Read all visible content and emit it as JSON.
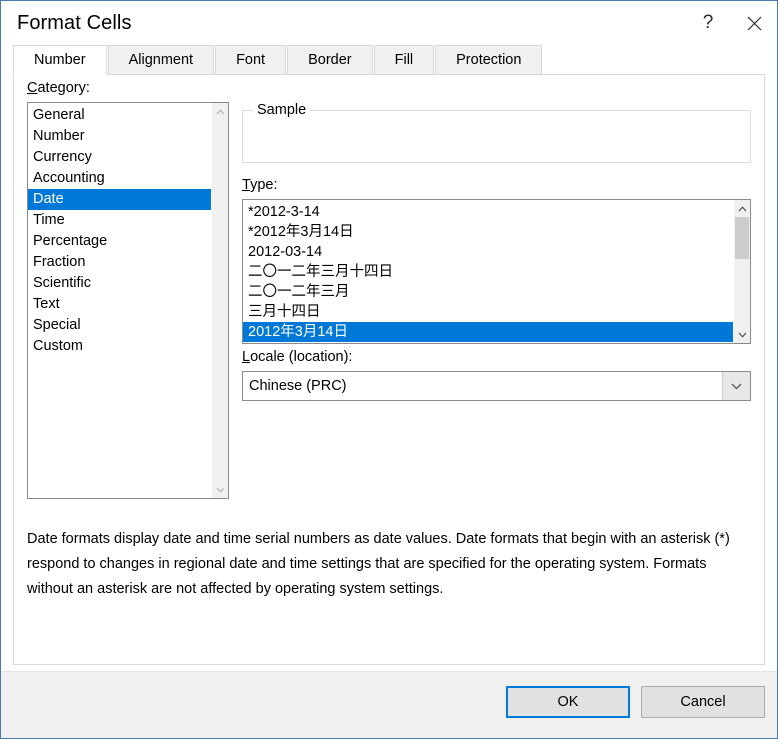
{
  "window": {
    "title": "Format Cells",
    "help_icon": "question-mark-icon",
    "close_icon": "close-icon"
  },
  "tabs": [
    {
      "label": "Number",
      "active": true
    },
    {
      "label": "Alignment",
      "active": false
    },
    {
      "label": "Font",
      "active": false
    },
    {
      "label": "Border",
      "active": false
    },
    {
      "label": "Fill",
      "active": false
    },
    {
      "label": "Protection",
      "active": false
    }
  ],
  "category": {
    "label_accel": "C",
    "label_rest": "ategory:",
    "items": [
      "General",
      "Number",
      "Currency",
      "Accounting",
      "Date",
      "Time",
      "Percentage",
      "Fraction",
      "Scientific",
      "Text",
      "Special",
      "Custom"
    ],
    "selected": "Date",
    "selected_index": 4
  },
  "sample": {
    "legend": "Sample",
    "value": ""
  },
  "type": {
    "label_accel": "T",
    "label_rest": "ype:",
    "items": [
      "*2012-3-14",
      "*2012年3月14日",
      "2012-03-14",
      "二〇一二年三月十四日",
      "二〇一二年三月",
      "三月十四日",
      "2012年3月14日"
    ],
    "selected": "2012年3月14日",
    "selected_index": 6
  },
  "locale": {
    "label_accel": "L",
    "label_rest": "ocale (location):",
    "value": "Chinese (PRC)",
    "dropdown_icon": "chevron-down-icon"
  },
  "description": "Date formats display date and time serial numbers as date values.  Date formats that begin with an asterisk (*) respond to changes in regional date and time settings that are specified for the operating system. Formats without an asterisk are not affected by operating system settings.",
  "footer": {
    "ok_label": "OK",
    "cancel_label": "Cancel"
  },
  "colors": {
    "selection_blue": "#0078d7",
    "dialog_border": "#4a7ba7",
    "footer_bg": "#f0f0f0",
    "control_border": "#8a8a8a"
  }
}
